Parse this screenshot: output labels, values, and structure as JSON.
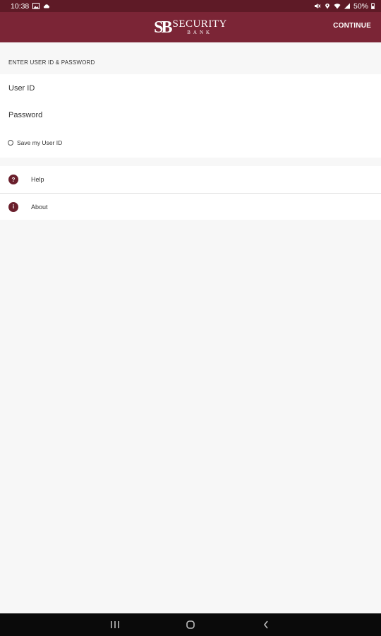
{
  "status_bar": {
    "time": "10:38",
    "battery": "50%",
    "icons": [
      "image-icon",
      "cloud-icon",
      "mute-icon",
      "location-icon",
      "wifi-icon",
      "signal-icon",
      "battery-icon"
    ]
  },
  "app_bar": {
    "logo_mark": "SB",
    "logo_word1": "SECURITY",
    "logo_word2": "BANK",
    "continue_label": "CONTINUE"
  },
  "login": {
    "section_heading": "ENTER USER ID & PASSWORD",
    "user_id_placeholder": "User ID",
    "password_placeholder": "Password",
    "save_user_id_label": "Save my User ID",
    "save_user_id_checked": false
  },
  "menu": {
    "items": [
      {
        "label": "Help",
        "icon": "help-icon",
        "glyph": "?"
      },
      {
        "label": "About",
        "icon": "info-icon",
        "glyph": "i"
      }
    ]
  },
  "nav_bar": {
    "buttons": [
      "recent-apps-icon",
      "home-icon",
      "back-icon"
    ]
  },
  "colors": {
    "status_bar": "#5e1a26",
    "app_bar": "#7b2536",
    "accent": "#6a1f2c",
    "background": "#f7f7f7"
  }
}
